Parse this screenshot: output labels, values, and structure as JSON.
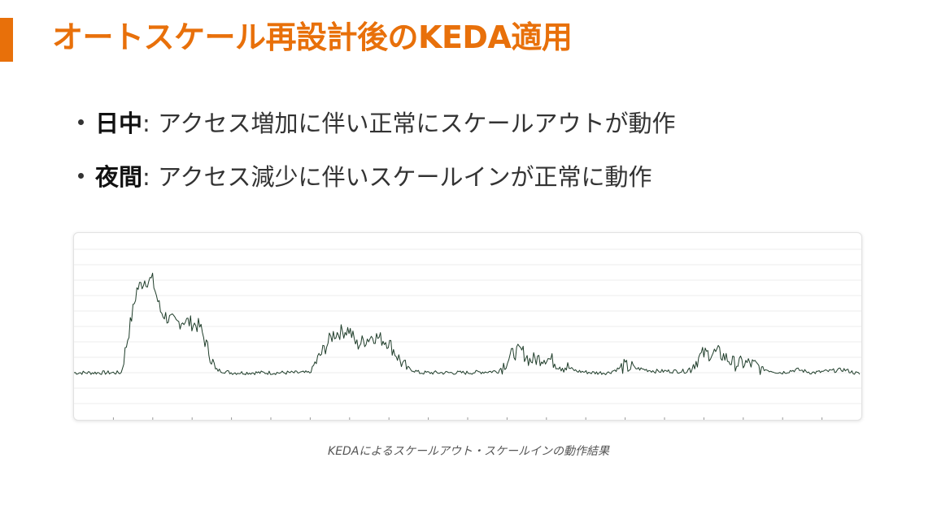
{
  "slide": {
    "title": "オートスケール再設計後のKEDA適用",
    "colors": {
      "accent": "#E8700A",
      "line": "#1f3d2a",
      "grid": "#eeeeee"
    }
  },
  "bullets": [
    {
      "label": "日中",
      "text": ": アクセス増加に伴い正常にスケールアウトが動作"
    },
    {
      "label": "夜間",
      "text": ": アクセス減少に伴いスケールインが正常に動作"
    }
  ],
  "caption": "KEDAによるスケールアウト・スケールインの動作結果",
  "chart_data": {
    "type": "line",
    "title": "",
    "xlabel": "",
    "ylabel": "",
    "grid": true,
    "ylim": [
      0,
      100
    ],
    "baseline": 20,
    "series": [
      {
        "x": [
          0,
          3,
          6,
          8,
          9,
          10,
          11,
          12,
          13,
          14,
          16,
          18,
          20,
          23,
          26,
          30,
          33,
          35,
          36,
          38,
          40,
          42,
          44,
          46,
          50,
          54,
          56,
          57,
          58,
          60,
          62,
          64,
          66,
          67,
          68,
          70,
          74,
          78,
          80,
          82,
          84,
          86,
          88,
          90,
          91,
          92,
          94,
          98,
          100
        ],
        "values": [
          20,
          20,
          20,
          74,
          80,
          80,
          60,
          55,
          52,
          54,
          50,
          22,
          20,
          20,
          20,
          20,
          45,
          48,
          38,
          44,
          40,
          24,
          20,
          20,
          20,
          21,
          33,
          34,
          28,
          30,
          25,
          21,
          20,
          20,
          20,
          24,
          21,
          21,
          32,
          33,
          26,
          26,
          22,
          20,
          21,
          22,
          20,
          22,
          19
        ]
      }
    ]
  }
}
